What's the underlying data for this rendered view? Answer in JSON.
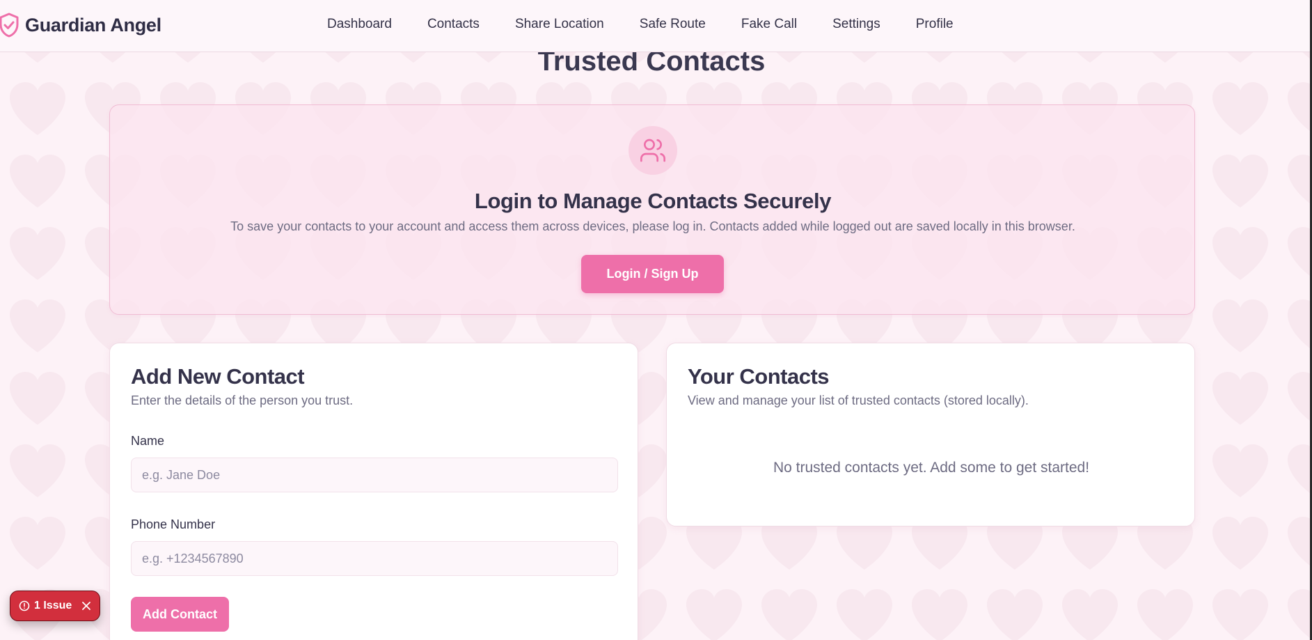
{
  "app": {
    "brand_name": "Guardian Angel",
    "accent_color": "#ee6fa9"
  },
  "nav": {
    "items": [
      {
        "label": "Dashboard"
      },
      {
        "label": "Contacts"
      },
      {
        "label": "Share Location"
      },
      {
        "label": "Safe Route"
      },
      {
        "label": "Fake Call"
      },
      {
        "label": "Settings"
      },
      {
        "label": "Profile"
      }
    ]
  },
  "page": {
    "title": "Trusted Contacts"
  },
  "login_card": {
    "icon": "users-icon",
    "title": "Login to Manage Contacts Securely",
    "description": "To save your contacts to your account and access them across devices, please log in. Contacts added while logged out are saved locally in this browser.",
    "button_label": "Login / Sign Up"
  },
  "add_contact": {
    "title": "Add New Contact",
    "subtitle": "Enter the details of the person you trust.",
    "name_label": "Name",
    "name_placeholder": "e.g. Jane Doe",
    "phone_label": "Phone Number",
    "phone_placeholder": "e.g. +1234567890",
    "button_label": "Add Contact"
  },
  "contacts_list": {
    "title": "Your Contacts",
    "subtitle": "View and manage your list of trusted contacts (stored locally).",
    "empty_message": "No trusted contacts yet. Add some to get started!"
  },
  "issue_badge": {
    "label": "1 Issue",
    "color": "#d22f3d"
  }
}
